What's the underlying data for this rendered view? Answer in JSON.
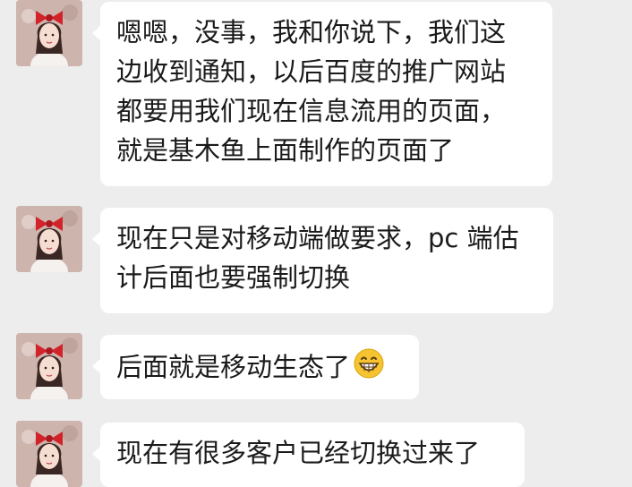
{
  "messages": [
    {
      "sender": "contact",
      "lines": [
        "嗯嗯，没事，我和你说下，我们这",
        "边收到通知，以后百度的推广网站",
        "都要用我们现在信息流用的页面，",
        "就是基木鱼上面制作的页面了"
      ]
    },
    {
      "sender": "contact",
      "lines": [
        "现在只是对移动端做要求，pc 端估",
        "计后面也要强制切换"
      ]
    },
    {
      "sender": "contact",
      "lines": [
        "后面就是移动生态了"
      ],
      "emoji": "grinning-face-emoji"
    },
    {
      "sender": "contact",
      "lines": [
        "现在有很多客户已经切换过来了"
      ]
    }
  ],
  "colors": {
    "background": "#ededed",
    "bubble": "#ffffff",
    "text": "#1a1a1a",
    "bow": "#d2232a"
  }
}
